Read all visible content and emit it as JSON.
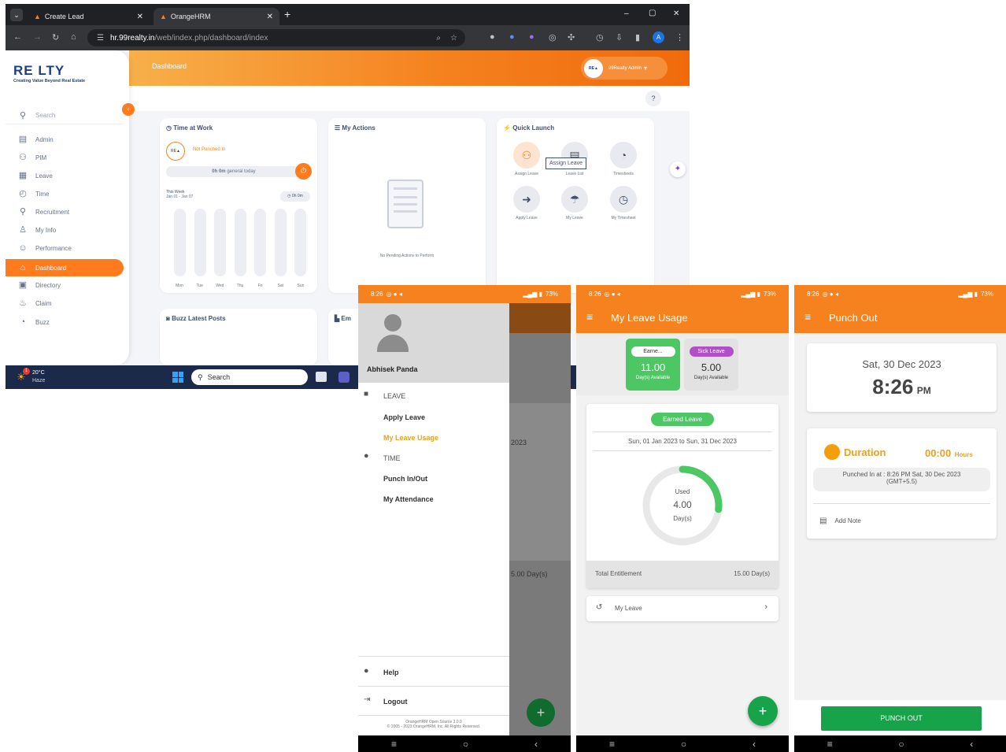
{
  "browser": {
    "tabs": [
      {
        "label": "Create Lead",
        "active": false
      },
      {
        "label": "OrangeHRM",
        "active": true
      }
    ],
    "url_host": "hr.99realty.in",
    "url_path": "/web/index.php/dashboard/index",
    "new_tab": "+",
    "window_controls": {
      "minimize": "–",
      "restore": "▢",
      "close": "✕"
    },
    "profile_letter": "A"
  },
  "webapp": {
    "logo_text": "RE LTY",
    "logo_tagline": "Creating Value Beyond Real Estate",
    "breadcrumb": "Dashboard",
    "user_name": "99Realty Admin",
    "user_caret": "▾",
    "help": "?",
    "sidebar": {
      "search_placeholder": "Search",
      "items": [
        {
          "label": "Admin",
          "active": false
        },
        {
          "label": "PIM",
          "active": false
        },
        {
          "label": "Leave",
          "active": false
        },
        {
          "label": "Time",
          "active": false
        },
        {
          "label": "Recruitment",
          "active": false
        },
        {
          "label": "My Info",
          "active": false
        },
        {
          "label": "Performance",
          "active": false
        },
        {
          "label": "Dashboard",
          "active": true
        },
        {
          "label": "Directory",
          "active": false
        },
        {
          "label": "Claim",
          "active": false
        },
        {
          "label": "Buzz",
          "active": false
        }
      ]
    },
    "time_at_work": {
      "title": "Time at Work",
      "status": "Not Punched In",
      "today_bold": "0h 0m",
      "today_rest": "general today",
      "week_label": "This Week",
      "week_range": "Jan 01 - Jan 07",
      "week_total": "0h 0m",
      "days": [
        "Mon",
        "Tue",
        "Wed",
        "Thu",
        "Fri",
        "Sat",
        "Sun"
      ]
    },
    "my_actions": {
      "title": "My Actions",
      "empty": "No Pending Actions to Perform"
    },
    "quick_launch": {
      "title": "Quick Launch",
      "tooltip": "Assign Leave",
      "items": [
        "Assign Leave",
        "Leave List",
        "Timesheets",
        "Apply Leave",
        "My Leave",
        "My Timesheet"
      ]
    },
    "buzz": {
      "title": "Buzz Latest Posts"
    },
    "employees_partial": "Em"
  },
  "taskbar": {
    "temp": "20°C",
    "weather": "Haze",
    "badge": "1",
    "search": "Search"
  },
  "phone_status": {
    "time": "8:26",
    "battery": "73%"
  },
  "phone1": {
    "user": "Abhisek Panda",
    "leave_header": "LEAVE",
    "apply_leave": "Apply Leave",
    "my_leave_usage": "My Leave Usage",
    "time_header": "TIME",
    "punch": "Punch In/Out",
    "attendance": "My Attendance",
    "help": "Help",
    "logout": "Logout",
    "footer1": "OrangeHRM Open Source 3.0.0",
    "footer2": "© 2005 - 2023 OrangeHRM, Inc. All Rights Reserved.",
    "bg_fragment1": "2023",
    "bg_fragment2": "5.00 Day(s)",
    "fab": "+"
  },
  "phone2": {
    "title": "My Leave Usage",
    "earned_chip": "Earne...",
    "earned_value": "11.00",
    "earned_sub": "Day(s) Available",
    "sick_chip": "Sick Leave",
    "sick_value": "5.00",
    "sick_sub": "Day(s) Available",
    "type_chip": "Earned Leave",
    "period": "Sun, 01 Jan 2023 to Sun, 31 Dec 2023",
    "used_label": "Used",
    "used_value": "4.00",
    "used_unit": "Day(s)",
    "used_fraction": 0.2667,
    "entitlement_label": "Total Entitlement",
    "entitlement_value": "15.00 Day(s)",
    "my_leave": "My Leave",
    "fab": "+"
  },
  "phone3": {
    "title": "Punch Out",
    "date": "Sat, 30 Dec 2023",
    "time": "8:26",
    "ampm": "PM",
    "duration_label": "Duration",
    "duration_value": "00:00",
    "duration_unit": "Hours",
    "punched_in": "Punched In at : 8:26 PM   Sat, 30 Dec 2023",
    "gmt": "(GMT+5.5)",
    "add_note": "Add Note",
    "button": "PUNCH OUT"
  },
  "colors": {
    "orange": "#f5821f",
    "green": "#16a34a",
    "light_green": "#4cc764",
    "purple": "#b04fc6",
    "navy": "#1d3f8a"
  }
}
